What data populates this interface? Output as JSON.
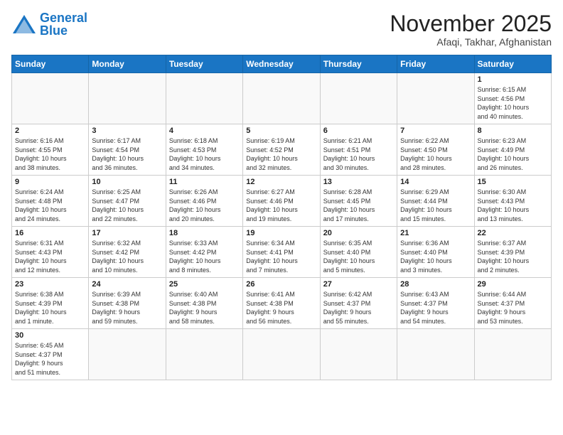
{
  "logo": {
    "general": "General",
    "blue": "Blue"
  },
  "title": "November 2025",
  "location": "Afaqi, Takhar, Afghanistan",
  "weekdays": [
    "Sunday",
    "Monday",
    "Tuesday",
    "Wednesday",
    "Thursday",
    "Friday",
    "Saturday"
  ],
  "weeks": [
    [
      {
        "day": "",
        "info": ""
      },
      {
        "day": "",
        "info": ""
      },
      {
        "day": "",
        "info": ""
      },
      {
        "day": "",
        "info": ""
      },
      {
        "day": "",
        "info": ""
      },
      {
        "day": "",
        "info": ""
      },
      {
        "day": "1",
        "info": "Sunrise: 6:15 AM\nSunset: 4:56 PM\nDaylight: 10 hours\nand 40 minutes."
      }
    ],
    [
      {
        "day": "2",
        "info": "Sunrise: 6:16 AM\nSunset: 4:55 PM\nDaylight: 10 hours\nand 38 minutes."
      },
      {
        "day": "3",
        "info": "Sunrise: 6:17 AM\nSunset: 4:54 PM\nDaylight: 10 hours\nand 36 minutes."
      },
      {
        "day": "4",
        "info": "Sunrise: 6:18 AM\nSunset: 4:53 PM\nDaylight: 10 hours\nand 34 minutes."
      },
      {
        "day": "5",
        "info": "Sunrise: 6:19 AM\nSunset: 4:52 PM\nDaylight: 10 hours\nand 32 minutes."
      },
      {
        "day": "6",
        "info": "Sunrise: 6:21 AM\nSunset: 4:51 PM\nDaylight: 10 hours\nand 30 minutes."
      },
      {
        "day": "7",
        "info": "Sunrise: 6:22 AM\nSunset: 4:50 PM\nDaylight: 10 hours\nand 28 minutes."
      },
      {
        "day": "8",
        "info": "Sunrise: 6:23 AM\nSunset: 4:49 PM\nDaylight: 10 hours\nand 26 minutes."
      }
    ],
    [
      {
        "day": "9",
        "info": "Sunrise: 6:24 AM\nSunset: 4:48 PM\nDaylight: 10 hours\nand 24 minutes."
      },
      {
        "day": "10",
        "info": "Sunrise: 6:25 AM\nSunset: 4:47 PM\nDaylight: 10 hours\nand 22 minutes."
      },
      {
        "day": "11",
        "info": "Sunrise: 6:26 AM\nSunset: 4:46 PM\nDaylight: 10 hours\nand 20 minutes."
      },
      {
        "day": "12",
        "info": "Sunrise: 6:27 AM\nSunset: 4:46 PM\nDaylight: 10 hours\nand 19 minutes."
      },
      {
        "day": "13",
        "info": "Sunrise: 6:28 AM\nSunset: 4:45 PM\nDaylight: 10 hours\nand 17 minutes."
      },
      {
        "day": "14",
        "info": "Sunrise: 6:29 AM\nSunset: 4:44 PM\nDaylight: 10 hours\nand 15 minutes."
      },
      {
        "day": "15",
        "info": "Sunrise: 6:30 AM\nSunset: 4:43 PM\nDaylight: 10 hours\nand 13 minutes."
      }
    ],
    [
      {
        "day": "16",
        "info": "Sunrise: 6:31 AM\nSunset: 4:43 PM\nDaylight: 10 hours\nand 12 minutes."
      },
      {
        "day": "17",
        "info": "Sunrise: 6:32 AM\nSunset: 4:42 PM\nDaylight: 10 hours\nand 10 minutes."
      },
      {
        "day": "18",
        "info": "Sunrise: 6:33 AM\nSunset: 4:42 PM\nDaylight: 10 hours\nand 8 minutes."
      },
      {
        "day": "19",
        "info": "Sunrise: 6:34 AM\nSunset: 4:41 PM\nDaylight: 10 hours\nand 7 minutes."
      },
      {
        "day": "20",
        "info": "Sunrise: 6:35 AM\nSunset: 4:40 PM\nDaylight: 10 hours\nand 5 minutes."
      },
      {
        "day": "21",
        "info": "Sunrise: 6:36 AM\nSunset: 4:40 PM\nDaylight: 10 hours\nand 3 minutes."
      },
      {
        "day": "22",
        "info": "Sunrise: 6:37 AM\nSunset: 4:39 PM\nDaylight: 10 hours\nand 2 minutes."
      }
    ],
    [
      {
        "day": "23",
        "info": "Sunrise: 6:38 AM\nSunset: 4:39 PM\nDaylight: 10 hours\nand 1 minute."
      },
      {
        "day": "24",
        "info": "Sunrise: 6:39 AM\nSunset: 4:38 PM\nDaylight: 9 hours\nand 59 minutes."
      },
      {
        "day": "25",
        "info": "Sunrise: 6:40 AM\nSunset: 4:38 PM\nDaylight: 9 hours\nand 58 minutes."
      },
      {
        "day": "26",
        "info": "Sunrise: 6:41 AM\nSunset: 4:38 PM\nDaylight: 9 hours\nand 56 minutes."
      },
      {
        "day": "27",
        "info": "Sunrise: 6:42 AM\nSunset: 4:37 PM\nDaylight: 9 hours\nand 55 minutes."
      },
      {
        "day": "28",
        "info": "Sunrise: 6:43 AM\nSunset: 4:37 PM\nDaylight: 9 hours\nand 54 minutes."
      },
      {
        "day": "29",
        "info": "Sunrise: 6:44 AM\nSunset: 4:37 PM\nDaylight: 9 hours\nand 53 minutes."
      }
    ],
    [
      {
        "day": "30",
        "info": "Sunrise: 6:45 AM\nSunset: 4:37 PM\nDaylight: 9 hours\nand 51 minutes."
      },
      {
        "day": "",
        "info": ""
      },
      {
        "day": "",
        "info": ""
      },
      {
        "day": "",
        "info": ""
      },
      {
        "day": "",
        "info": ""
      },
      {
        "day": "",
        "info": ""
      },
      {
        "day": "",
        "info": ""
      }
    ]
  ]
}
